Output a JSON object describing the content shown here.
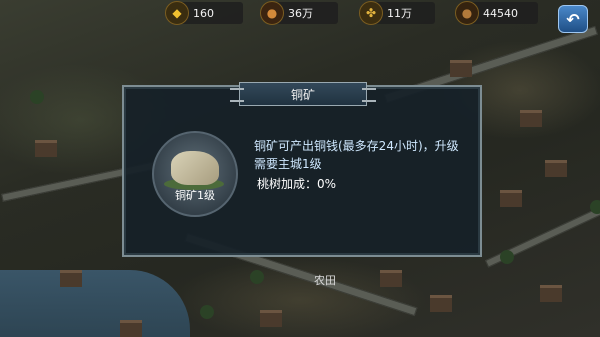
{
  "resources": [
    {
      "name": "gold",
      "value": "160",
      "icon": "gold-ingot-icon",
      "color": "#f0c030"
    },
    {
      "name": "food",
      "value": "36万",
      "icon": "food-bowl-icon",
      "color": "#d48a3a"
    },
    {
      "name": "wheat",
      "value": "11万",
      "icon": "wheat-icon",
      "color": "#e1b33e"
    },
    {
      "name": "copper",
      "value": "44540",
      "icon": "coin-bag-icon",
      "color": "#b27a3b"
    }
  ],
  "dialog": {
    "title": "铜矿",
    "building_label": "铜矿1级",
    "description": "铜矿可产出铜钱(最多存24小时)，升级需要主城1级",
    "bonus": "桃树加成：0%"
  },
  "map": {
    "farm_label": "农田"
  }
}
